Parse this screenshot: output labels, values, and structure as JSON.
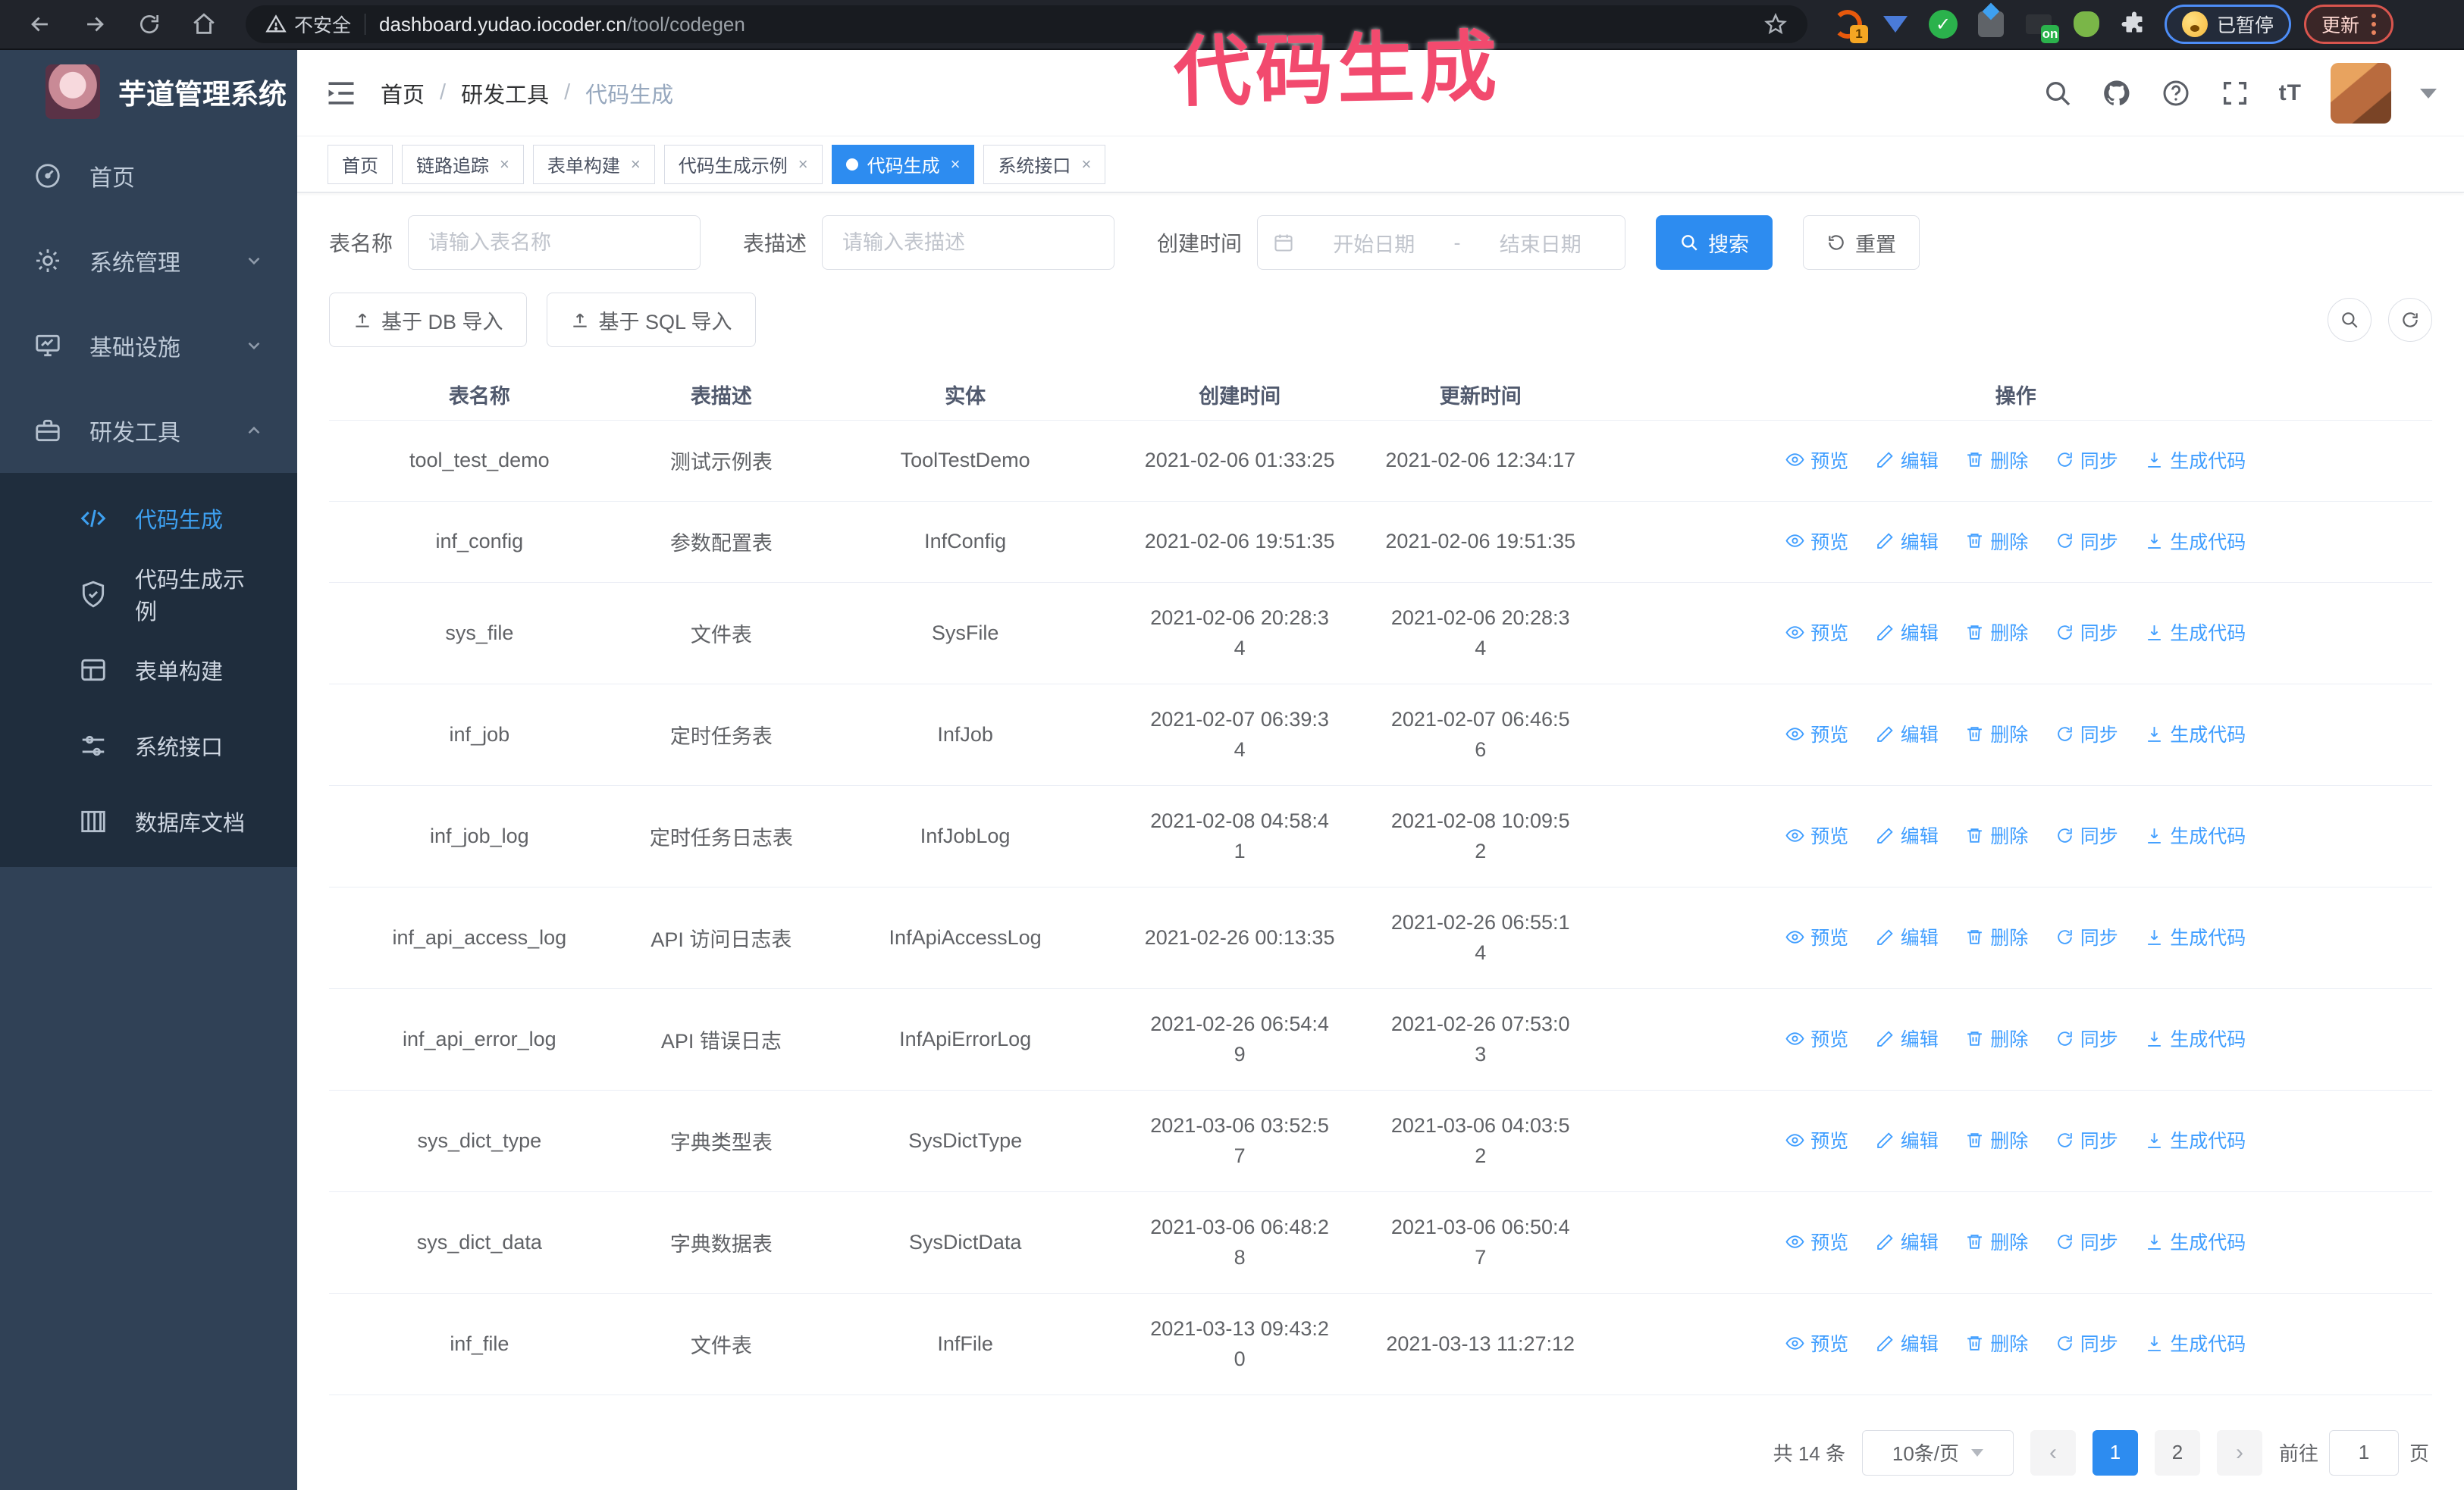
{
  "annotation": {
    "text": "代码生成",
    "color": "#f24a6e"
  },
  "browser": {
    "security_label": "不安全",
    "url_host": "dashboard.yudao.iocoder.cn",
    "url_path": "/tool/codegen",
    "extension_badge_1": "1",
    "extension_badge_on": "on",
    "paused_badge": "已暂停",
    "update_button": "更新"
  },
  "sidebar": {
    "title": "芋道管理系统",
    "items": [
      {
        "label": "首页",
        "icon": "dashboard-icon"
      },
      {
        "label": "系统管理",
        "icon": "gear-icon",
        "chevron": "down"
      },
      {
        "label": "基础设施",
        "icon": "monitor-icon",
        "chevron": "down"
      },
      {
        "label": "研发工具",
        "icon": "toolbox-icon",
        "chevron": "up"
      }
    ],
    "submenu": [
      {
        "label": "代码生成",
        "icon": "code-icon",
        "active": true
      },
      {
        "label": "代码生成示例",
        "icon": "shield-check-icon",
        "active": false
      },
      {
        "label": "表单构建",
        "icon": "form-icon",
        "active": false
      },
      {
        "label": "系统接口",
        "icon": "sliders-icon",
        "active": false
      },
      {
        "label": "数据库文档",
        "icon": "database-icon",
        "active": false
      }
    ]
  },
  "header": {
    "breadcrumb": [
      "首页",
      "研发工具",
      "代码生成"
    ],
    "separator": "/"
  },
  "tabs": [
    {
      "label": "首页",
      "closable": false,
      "active": false
    },
    {
      "label": "链路追踪",
      "closable": true,
      "active": false
    },
    {
      "label": "表单构建",
      "closable": true,
      "active": false
    },
    {
      "label": "代码生成示例",
      "closable": true,
      "active": false
    },
    {
      "label": "代码生成",
      "closable": true,
      "active": true
    },
    {
      "label": "系统接口",
      "closable": true,
      "active": false
    }
  ],
  "filters": {
    "table_name_label": "表名称",
    "table_name_placeholder": "请输入表名称",
    "table_desc_label": "表描述",
    "table_desc_placeholder": "请输入表描述",
    "create_time_label": "创建时间",
    "date_start_placeholder": "开始日期",
    "date_separator": "-",
    "date_end_placeholder": "结束日期",
    "search_label": "搜索",
    "reset_label": "重置",
    "import_db_label": "基于 DB 导入",
    "import_sql_label": "基于 SQL 导入"
  },
  "table": {
    "columns": [
      "表名称",
      "表描述",
      "实体",
      "创建时间",
      "更新时间",
      "操作"
    ],
    "actions": [
      "预览",
      "编辑",
      "删除",
      "同步",
      "生成代码"
    ],
    "rows": [
      {
        "name": "tool_test_demo",
        "desc": "测试示例表",
        "entity": "ToolTestDemo",
        "created": [
          "2021-02-06 01:33:25"
        ],
        "updated": [
          "2021-02-06 12:34:17"
        ]
      },
      {
        "name": "inf_config",
        "desc": "参数配置表",
        "entity": "InfConfig",
        "created": [
          "2021-02-06 19:51:35"
        ],
        "updated": [
          "2021-02-06 19:51:35"
        ]
      },
      {
        "name": "sys_file",
        "desc": "文件表",
        "entity": "SysFile",
        "created": [
          "2021-02-06 20:28:3",
          "4"
        ],
        "updated": [
          "2021-02-06 20:28:3",
          "4"
        ]
      },
      {
        "name": "inf_job",
        "desc": "定时任务表",
        "entity": "InfJob",
        "created": [
          "2021-02-07 06:39:3",
          "4"
        ],
        "updated": [
          "2021-02-07 06:46:5",
          "6"
        ]
      },
      {
        "name": "inf_job_log",
        "desc": "定时任务日志表",
        "entity": "InfJobLog",
        "created": [
          "2021-02-08 04:58:4",
          "1"
        ],
        "updated": [
          "2021-02-08 10:09:5",
          "2"
        ]
      },
      {
        "name": "inf_api_access_log",
        "desc": "API 访问日志表",
        "entity": "InfApiAccessLog",
        "created": [
          "2021-02-26 00:13:35"
        ],
        "updated": [
          "2021-02-26 06:55:1",
          "4"
        ]
      },
      {
        "name": "inf_api_error_log",
        "desc": "API 错误日志",
        "entity": "InfApiErrorLog",
        "created": [
          "2021-02-26 06:54:4",
          "9"
        ],
        "updated": [
          "2021-02-26 07:53:0",
          "3"
        ]
      },
      {
        "name": "sys_dict_type",
        "desc": "字典类型表",
        "entity": "SysDictType",
        "created": [
          "2021-03-06 03:52:5",
          "7"
        ],
        "updated": [
          "2021-03-06 04:03:5",
          "2"
        ]
      },
      {
        "name": "sys_dict_data",
        "desc": "字典数据表",
        "entity": "SysDictData",
        "created": [
          "2021-03-06 06:48:2",
          "8"
        ],
        "updated": [
          "2021-03-06 06:50:4",
          "7"
        ]
      },
      {
        "name": "inf_file",
        "desc": "文件表",
        "entity": "InfFile",
        "created": [
          "2021-03-13 09:43:2",
          "0"
        ],
        "updated": [
          "2021-03-13 11:27:12"
        ]
      }
    ]
  },
  "pagination": {
    "total_label": "共 14 条",
    "page_size": "10条/页",
    "prev": "‹",
    "next": "›",
    "pages": [
      "1",
      "2"
    ],
    "active_page": "1",
    "goto_label": "前往",
    "goto_value": "1",
    "page_suffix_label": "页"
  },
  "colors": {
    "accent_blue": "#2d8cf0",
    "link_blue": "#409eff",
    "sidebar_bg": "#304156",
    "submenu_bg": "#1f2d3d",
    "annotation_pink": "#f24a6e"
  }
}
